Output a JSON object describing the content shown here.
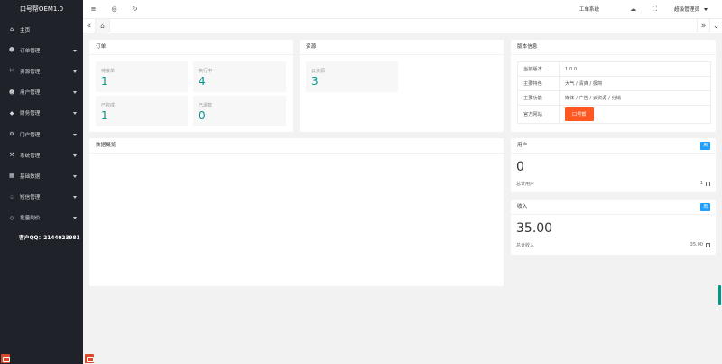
{
  "app": {
    "title": "口号帮OEM1.0"
  },
  "sidebar": {
    "items": [
      {
        "label": "主页",
        "icon": "home-icon",
        "glyph": "⌂",
        "has_arrow": false
      },
      {
        "label": "订单管理",
        "icon": "user-icon",
        "glyph": "☻",
        "has_arrow": true
      },
      {
        "label": "资源管理",
        "icon": "flag-icon",
        "glyph": "⚐",
        "has_arrow": true
      },
      {
        "label": "用户管理",
        "icon": "user-icon",
        "glyph": "☻",
        "has_arrow": true
      },
      {
        "label": "财务管理",
        "icon": "diamond-icon",
        "glyph": "◆",
        "has_arrow": true
      },
      {
        "label": "门户管理",
        "icon": "gear-icon",
        "glyph": "⚙",
        "has_arrow": true
      },
      {
        "label": "系统管理",
        "icon": "tools-icon",
        "glyph": "⚒",
        "has_arrow": true
      },
      {
        "label": "基础数据",
        "icon": "template-icon",
        "glyph": "▦",
        "has_arrow": true
      },
      {
        "label": "短信管理",
        "icon": "bell-icon",
        "glyph": "♤",
        "has_arrow": true
      },
      {
        "label": "批量刷价",
        "icon": "diamond-icon",
        "glyph": "◇",
        "has_arrow": true
      }
    ],
    "qq_text": "客户QQ：2144023981"
  },
  "header": {
    "menu_icon": "≡",
    "theme_icon": "◎",
    "refresh_icon": "↻",
    "system_msg": "工单系统",
    "cloud_icon": "☁",
    "fullscreen_icon": "⛶",
    "admin_label": "超级管理员"
  },
  "tabs": {
    "prev": "«",
    "home": "⌂",
    "next": "»",
    "more": "⌄"
  },
  "orders": {
    "title": "订单",
    "stats": [
      {
        "label": "待接单",
        "value": "1"
      },
      {
        "label": "执行中",
        "value": "4"
      },
      {
        "label": "已完成",
        "value": "1"
      },
      {
        "label": "已退款",
        "value": "0"
      }
    ]
  },
  "resources": {
    "title": "资源",
    "stats": [
      {
        "label": "云资源",
        "value": "3"
      }
    ]
  },
  "version": {
    "title": "版本信息",
    "rows": [
      {
        "key": "当前版本",
        "value": "1.0.0"
      },
      {
        "key": "主要特色",
        "value": "大气 / 清爽 / 极简"
      },
      {
        "key": "主要功能",
        "value": "媒体 / 广告 / 云资源 / 分销"
      },
      {
        "key": "官方网站",
        "button": "口号帮"
      }
    ]
  },
  "overview": {
    "title": "数据概览"
  },
  "users_card": {
    "title": "用户",
    "badge": "周",
    "value": "0",
    "sub_label": "总计用户",
    "sub_value": "1"
  },
  "income_card": {
    "title": "收入",
    "badge": "周",
    "value": "35.00",
    "sub_label": "总计收入",
    "sub_value": "35.00"
  }
}
